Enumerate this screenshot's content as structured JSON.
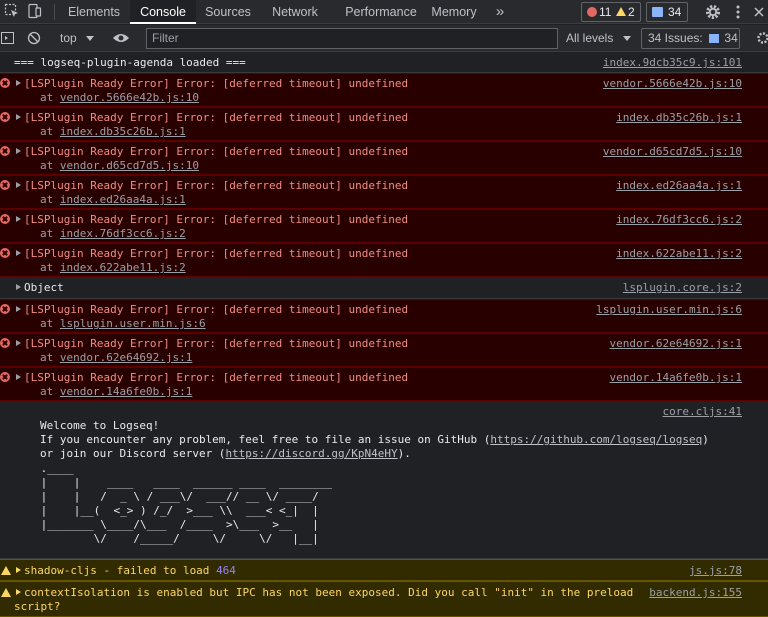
{
  "tabs": [
    "Elements",
    "Console",
    "Sources",
    "Network",
    "Performance",
    "Memory"
  ],
  "more_tabs": "»",
  "badges": {
    "errors": "11",
    "warnings": "2",
    "messages": "34"
  },
  "filterbar": {
    "context": "top",
    "filter_placeholder": "Filter",
    "levels": "All levels",
    "issues_label": "34 Issues:",
    "issues_count": "34"
  },
  "console": {
    "agenda_loaded": {
      "text": "=== logseq-plugin-agenda loaded ===",
      "source": "index.9dcb35c9.js:101"
    },
    "errors": [
      {
        "message": "[LSPlugin Ready Error] Error: [deferred timeout] undefined",
        "at": "at",
        "file": "vendor.5666e42b.js:10",
        "source": "vendor.5666e42b.js:10"
      },
      {
        "message": "[LSPlugin Ready Error] Error: [deferred timeout] undefined",
        "at": "at",
        "file": "index.db35c26b.js:1",
        "source": "index.db35c26b.js:1"
      },
      {
        "message": "[LSPlugin Ready Error] Error: [deferred timeout] undefined",
        "at": "at",
        "file": "vendor.d65cd7d5.js:10",
        "source": "vendor.d65cd7d5.js:10"
      },
      {
        "message": "[LSPlugin Ready Error] Error: [deferred timeout] undefined",
        "at": "at",
        "file": "index.ed26aa4a.js:1",
        "source": "index.ed26aa4a.js:1"
      },
      {
        "message": "[LSPlugin Ready Error] Error: [deferred timeout] undefined",
        "at": "at",
        "file": "index.76df3cc6.js:2",
        "source": "index.76df3cc6.js:2"
      },
      {
        "message": "[LSPlugin Ready Error] Error: [deferred timeout] undefined",
        "at": "at",
        "file": "index.622abe11.js:2",
        "source": "index.622abe11.js:2"
      }
    ],
    "object_row": {
      "text": "Object",
      "source": "lsplugin.core.js:2"
    },
    "errors2": [
      {
        "message": "[LSPlugin Ready Error] Error: [deferred timeout] undefined",
        "at": "at",
        "file": "lsplugin.user.min.js:6",
        "source": "lsplugin.user.min.js:6"
      },
      {
        "message": "[LSPlugin Ready Error] Error: [deferred timeout] undefined",
        "at": "at",
        "file": "vendor.62e64692.js:1",
        "source": "vendor.62e64692.js:1"
      },
      {
        "message": "[LSPlugin Ready Error] Error: [deferred timeout] undefined",
        "at": "at",
        "file": "vendor.14a6fe0b.js:1",
        "source": "vendor.14a6fe0b.js:1"
      }
    ],
    "welcome": {
      "source": "core.cljs:41",
      "line1": "Welcome to Logseq!",
      "line2a": "If you encounter any problem, feel free to file an issue on GitHub (",
      "github_url": "https://github.com/logseq/logseq",
      "line2b": ")",
      "line3a": "or join our Discord server (",
      "discord_url": "https://discord.gg/KpN4eHY",
      "line3b": ").",
      "ascii": [
        " .____",
        " |    |    ____   ____  ______ ____  ________",
        " |    |   /  _ \\ / ___\\/  ___// __ \\/ ____/",
        " |    |__(  <_> ) /_/  >___ \\\\  ___< <_|  |",
        " |_______ \\____/\\___  /____  >\\___  >__   |",
        "         \\/    /_____/     \\/     \\/   |__|"
      ]
    },
    "warnings": [
      {
        "text": "shadow-cljs - failed to load ",
        "count": "464",
        "source": "js.js:78"
      },
      {
        "text": "contextIsolation is enabled but IPC has not been exposed. Did you call \"init\" in the preload",
        "text2": "script?",
        "source": "backend.js:155"
      }
    ]
  },
  "colors": {
    "error_bg": "#290000",
    "error_text": "#f28b82",
    "warning_bg": "#332b00",
    "warning_text": "#fdd663",
    "accent_blue": "#8ab4f8"
  }
}
